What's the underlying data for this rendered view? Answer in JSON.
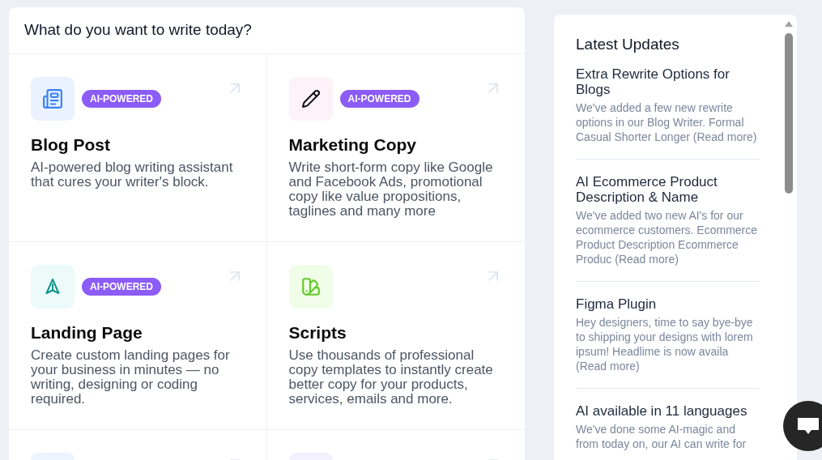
{
  "main_card": {
    "title": "What do you want to write today?",
    "cards": [
      {
        "title": "Blog Post",
        "badge": "AI-POWERED",
        "description": "AI-powered blog writing assistant that cures your writer's block."
      },
      {
        "title": "Marketing Copy",
        "badge": "AI-POWERED",
        "description": "Write short-form copy like Google and Facebook Ads, promotional copy like value propositions, taglines and many more"
      },
      {
        "title": "Landing Page",
        "badge": "AI-POWERED",
        "description": "Create custom landing pages for your business in minutes — no writing, designing or coding required."
      },
      {
        "title": "Scripts",
        "description": "Use thousands of professional copy templates to instantly create better copy for your products, services, emails and more."
      }
    ]
  },
  "updates_panel": {
    "title": "Latest Updates",
    "items": [
      {
        "title": "Extra Rewrite Options for Blogs",
        "description": "We've added a few new rewrite options in our Blog Writer. Formal Casual Shorter Longer (Read more)"
      },
      {
        "title": "AI Ecommerce Product Description & Name",
        "description": "We've added two new AI's for our ecommerce customers. Ecommerce Product Description Ecommerce Produc (Read more)"
      },
      {
        "title": "Figma Plugin",
        "description": "Hey designers, time to say bye-bye to shipping your designs with lorem ipsum! Headlime is now availa (Read more)"
      },
      {
        "title": "AI available in 11 languages",
        "description": "We've done some AI-magic and from today on, our AI can write for"
      }
    ]
  }
}
